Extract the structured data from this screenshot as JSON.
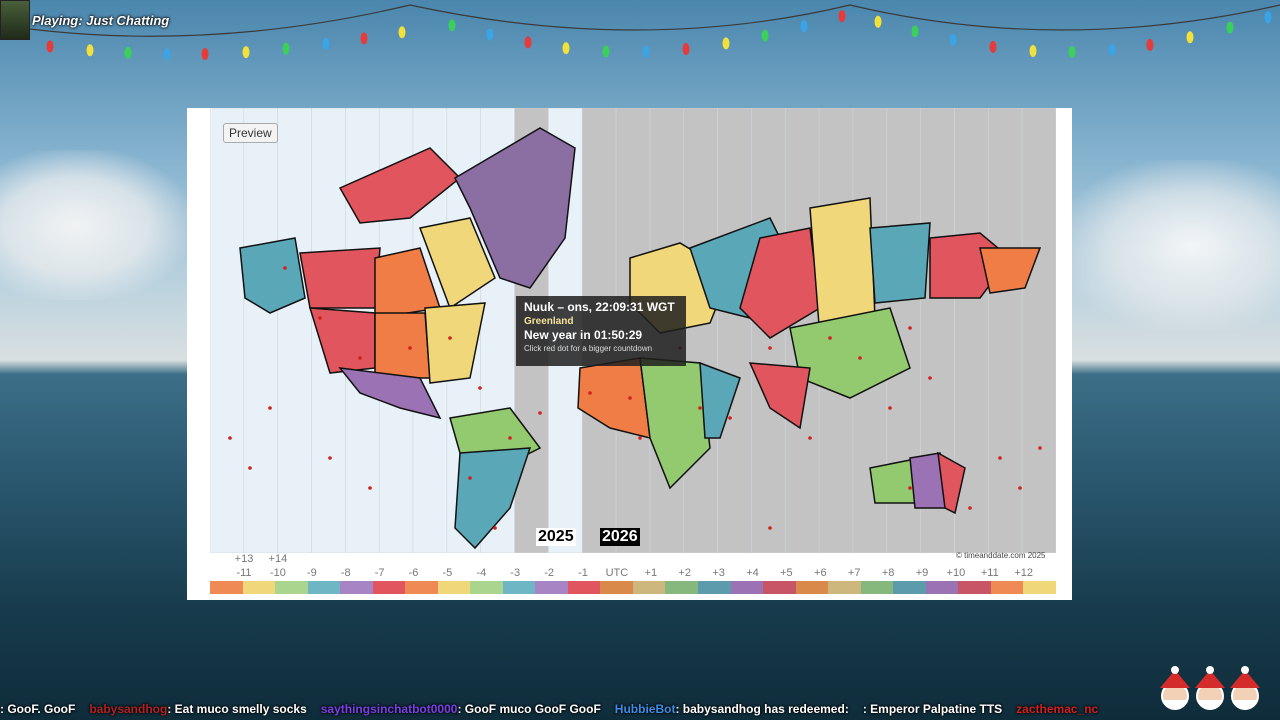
{
  "stream": {
    "playing_text": "Playing: Just Chatting"
  },
  "map": {
    "preview_button": "Preview",
    "year_left": "2025",
    "year_right": "2026",
    "copyright": "© timeanddate.com 2025",
    "tooltip": {
      "title": "Nuuk – ons, 22:09:31 WGT",
      "country": "Greenland",
      "countdown": "New year in 01:50:29",
      "hint": "Click red dot for a bigger countdown"
    },
    "upper_labels": [
      "+13",
      "+14"
    ],
    "lower_labels": [
      "-11",
      "-10",
      "-9",
      "-8",
      "-7",
      "-6",
      "-5",
      "-4",
      "-3",
      "-2",
      "-1",
      "UTC",
      "+1",
      "+2",
      "+3",
      "+4",
      "+5",
      "+6",
      "+7",
      "+8",
      "+9",
      "+10",
      "+11",
      "+12"
    ],
    "colors": {
      "night": "#bfbfbf",
      "day": "#e8f1f8",
      "greenland": "#8b6fa3",
      "red": "#e0555e",
      "orange": "#ef7d45",
      "yellow": "#f0d77a",
      "green": "#93c96f",
      "teal": "#5aa7b7",
      "purple": "#9b73b5"
    },
    "colorbar": [
      "#ef8a55",
      "#f0d77a",
      "#a9d58e",
      "#6fb6c4",
      "#a785c4",
      "#e0555e",
      "#ef8a55",
      "#f0d77a",
      "#a9d58e",
      "#6fb6c4",
      "#a785c4",
      "#e0555e",
      "#d9894a",
      "#cdb77c",
      "#86b77c",
      "#5c9bab",
      "#9b73b5",
      "#c85566",
      "#d9894a",
      "#cdb77c",
      "#86b77c",
      "#5c9bab",
      "#9b73b5",
      "#c85566",
      "#ef8a55",
      "#f0d77a"
    ]
  },
  "chat": {
    "messages": [
      {
        "user": "",
        "text": ": GooF. GooF",
        "color": "#ffffff"
      },
      {
        "user": "babysandhog",
        "text": ": Eat muco smelly socks",
        "color": "#b22222"
      },
      {
        "user": "saythingsinchatbot0000",
        "text": ": GooF muco GooF GooF",
        "color": "#7b3fe4"
      },
      {
        "user": "HubbieBot",
        "text": ": babysandhog has redeemed: ",
        "color": "#3b8ee8"
      },
      {
        "user": "",
        "text": ": Emperor Palpatine TTS",
        "color": "#ffffff"
      },
      {
        "user": "zacthemac_nc",
        "text": "",
        "color": "#d02020"
      }
    ]
  }
}
